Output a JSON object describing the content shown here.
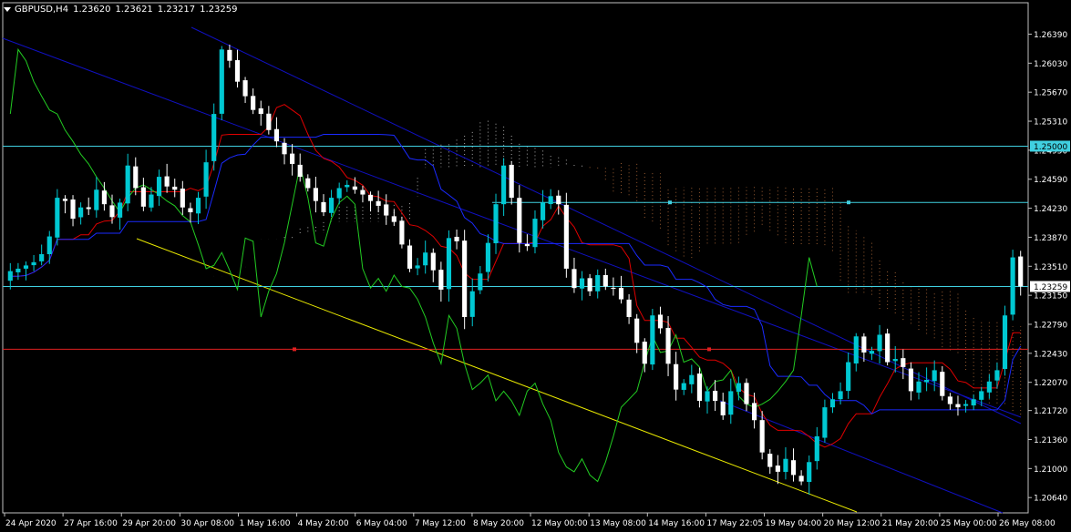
{
  "header": {
    "symbol": "GBPUSD,H4",
    "open": "1.23620",
    "high": "1.23621",
    "low": "1.23217",
    "close": "1.23259"
  },
  "colors": {
    "background": "#000000",
    "frame": "#c0c0c0",
    "text": "#ffffff",
    "bull_candle": "#00c8d2",
    "bear_candle": "#ffffff",
    "tenkan": "#e00000",
    "kijun": "#1a2aff",
    "chikou": "#22cc22",
    "cloud": "#e0e0e0",
    "cloud_alt": "#c87840",
    "channel": "#1010c0",
    "trendline": "#e8e800",
    "hline_cyan": "#40d0e0",
    "hline_red": "#e02020",
    "price_marker": "#ffffff"
  },
  "chart_data": {
    "type": "candlestick",
    "instrument": "GBPUSD",
    "timeframe": "H4",
    "ylim": [
      1.2045,
      1.2678
    ],
    "y_ticks": [
      "1.26390",
      "1.26030",
      "1.25670",
      "1.25310",
      "1.24950",
      "1.24590",
      "1.24230",
      "1.23870",
      "1.23510",
      "1.23150",
      "1.22790",
      "1.22430",
      "1.22070",
      "1.21720",
      "1.21360",
      "1.21000",
      "1.20640"
    ],
    "x_labels": [
      "24 Apr 2020",
      "27 Apr 16:00",
      "29 Apr 20:00",
      "30 Apr 08:00",
      "1 May 16:00",
      "4 May 20:00",
      "6 May 04:00",
      "7 May 12:00",
      "8 May 20:00",
      "12 May 00:00",
      "13 May 08:00",
      "14 May 16:00",
      "17 May 22:05",
      "19 May 04:00",
      "20 May 12:00",
      "21 May 20:00",
      "25 May 00:00",
      "26 May 08:00"
    ],
    "bar_count": 130,
    "closes": [
      1.2345,
      1.2348,
      1.2352,
      1.2356,
      1.2366,
      1.2388,
      1.2436,
      1.2432,
      1.241,
      1.2424,
      1.2422,
      1.2446,
      1.2428,
      1.2412,
      1.243,
      1.2476,
      1.2448,
      1.2425,
      1.244,
      1.2462,
      1.245,
      1.2446,
      1.2424,
      1.2418,
      1.2436,
      1.248,
      1.254,
      1.262,
      1.2606,
      1.258,
      1.2562,
      1.2545,
      1.254,
      1.252,
      1.2506,
      1.249,
      1.2478,
      1.2462,
      1.2448,
      1.2432,
      1.2418,
      1.2436,
      1.2448,
      1.2452,
      1.2446,
      1.244,
      1.2432,
      1.2426,
      1.2414,
      1.2406,
      1.2378,
      1.2348,
      1.2352,
      1.2368,
      1.2346,
      1.2322,
      1.2386,
      1.2382,
      1.2288,
      1.232,
      1.2342,
      1.238,
      1.2428,
      1.2476,
      1.2436,
      1.238,
      1.2376,
      1.241,
      1.243,
      1.2438,
      1.2428,
      1.2348,
      1.2324,
      1.2336,
      1.232,
      1.234,
      1.2326,
      1.2324,
      1.231,
      1.2288,
      1.2256,
      1.223,
      1.229,
      1.2274,
      1.223,
      1.2198,
      1.2206,
      1.2216,
      1.2184,
      1.2196,
      1.2184,
      1.2166,
      1.2196,
      1.2206,
      1.218,
      1.216,
      1.212,
      1.2102,
      1.2096,
      1.2112,
      1.2092,
      1.2084,
      1.2108,
      1.214,
      1.2176,
      1.2186,
      1.2196,
      1.2232,
      1.2264,
      1.2244,
      1.2246,
      1.2266,
      1.2232,
      1.2236,
      1.2226,
      1.2196,
      1.2208,
      1.221,
      1.2222,
      1.219,
      1.218,
      1.2176,
      1.218,
      1.2186,
      1.2196,
      1.2208,
      1.2222,
      1.229,
      1.2362,
      1.2326
    ],
    "last_price": "1.23259",
    "horizontal_levels": [
      {
        "price": 1.25,
        "label": "1.25000",
        "color": "#40d0e0"
      },
      {
        "price": 1.24302,
        "label": "",
        "color": "#40d0e0"
      },
      {
        "price": 1.23259,
        "label": "",
        "color": "#40d0e0"
      },
      {
        "price": 1.2248,
        "label": "",
        "color": "#e02020"
      }
    ],
    "indicators": [
      "Ichimoku Kinko Hyo",
      "Channel",
      "Trendline"
    ],
    "grid": false
  }
}
